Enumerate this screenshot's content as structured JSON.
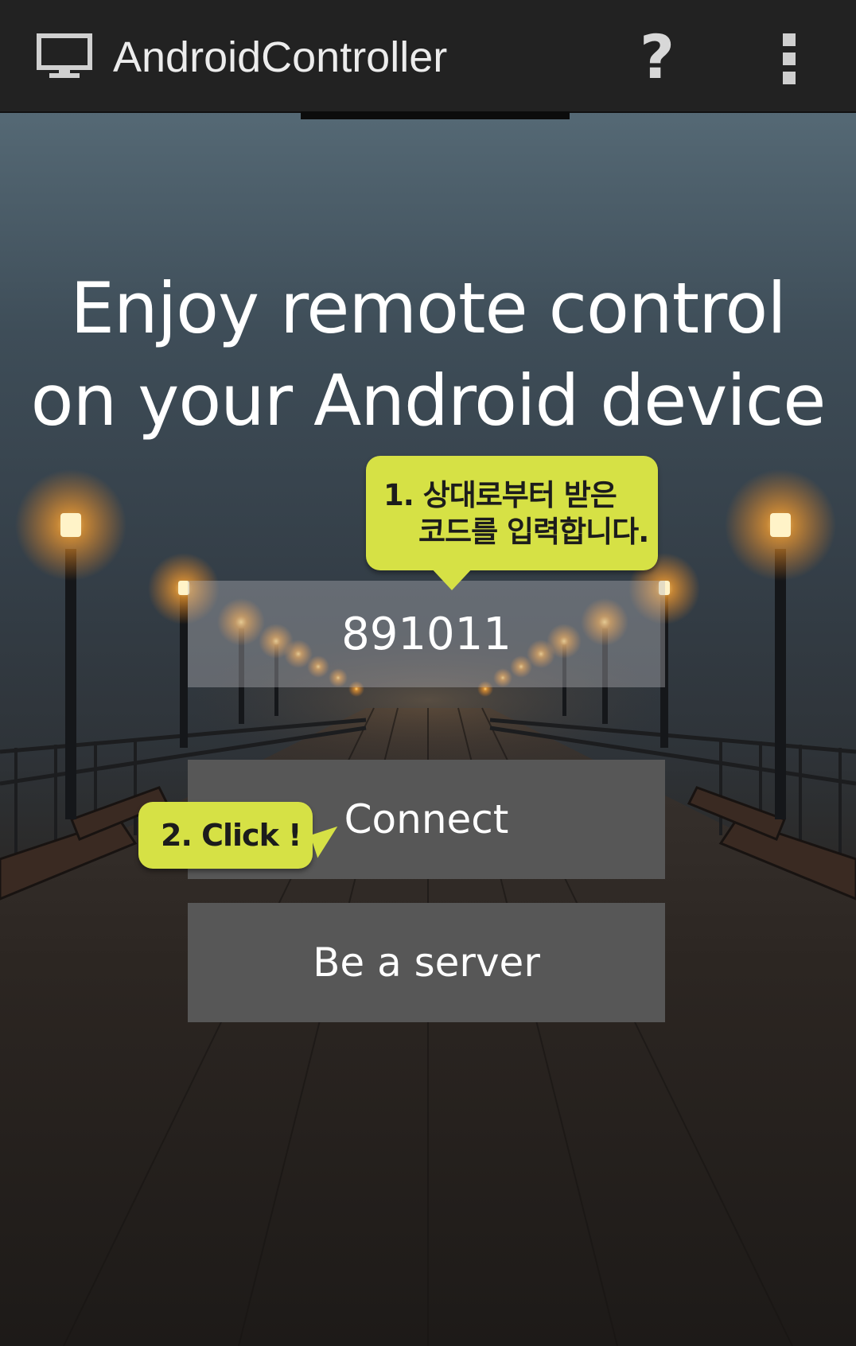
{
  "action_bar": {
    "title": "AndroidController",
    "app_icon": "monitor-icon",
    "help_icon": "question-mark-icon",
    "overflow_icon": "overflow-menu-icon",
    "help_label": "?"
  },
  "main": {
    "headline_line1": "Enjoy remote control",
    "headline_line2": "on your Android device",
    "code_value": "891011",
    "connect_label": "Connect",
    "server_label": "Be a server"
  },
  "tooltips": {
    "step1_line1": "1. 상대로부터 받은",
    "step1_line2": "코드를 입력합니다.",
    "step2": "2. Click !"
  },
  "colors": {
    "action_bar": "#222222",
    "bubble": "#d6e145",
    "button": "#575757",
    "lamp_glow": "#ffb23a"
  }
}
